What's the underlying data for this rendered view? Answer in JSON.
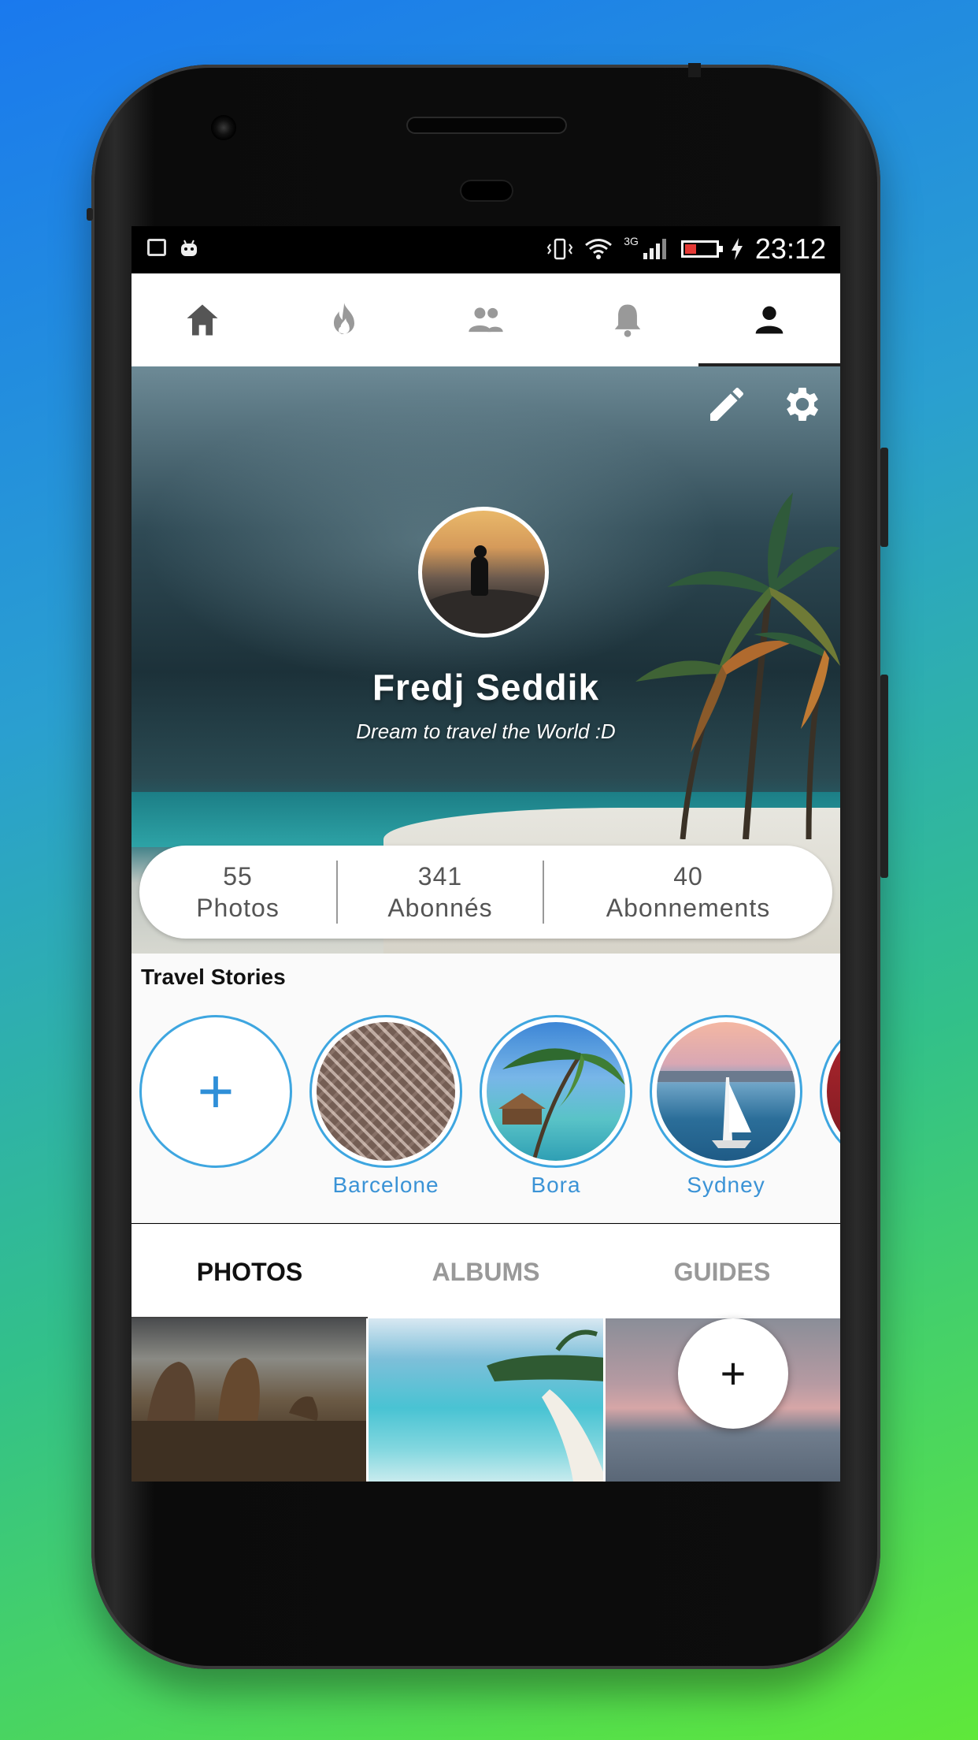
{
  "status_bar": {
    "time": "23:12",
    "network": "3G"
  },
  "nav_tabs": [
    {
      "icon": "home-icon"
    },
    {
      "icon": "flame-icon"
    },
    {
      "icon": "group-icon"
    },
    {
      "icon": "bell-icon"
    },
    {
      "icon": "person-icon",
      "active": true
    }
  ],
  "profile": {
    "name": "Fredj  Seddik",
    "bio": "Dream to travel the World :D"
  },
  "stats": [
    {
      "value": "55",
      "label": "Photos"
    },
    {
      "value": "341",
      "label": "Abonnés"
    },
    {
      "value": "40",
      "label": "Abonnements"
    }
  ],
  "stories": {
    "title": "Travel Stories",
    "add_label": "+",
    "items": [
      {
        "label": "Barcelone"
      },
      {
        "label": "Bora"
      },
      {
        "label": "Sydney"
      }
    ]
  },
  "content_tabs": [
    {
      "label": "PHOTOS",
      "active": true
    },
    {
      "label": "ALBUMS"
    },
    {
      "label": "GUIDES"
    }
  ],
  "fab": {
    "label": "+"
  },
  "colors": {
    "accent": "#3ea6e0",
    "story_label": "#3b93d6",
    "battery_low": "#e53935"
  }
}
